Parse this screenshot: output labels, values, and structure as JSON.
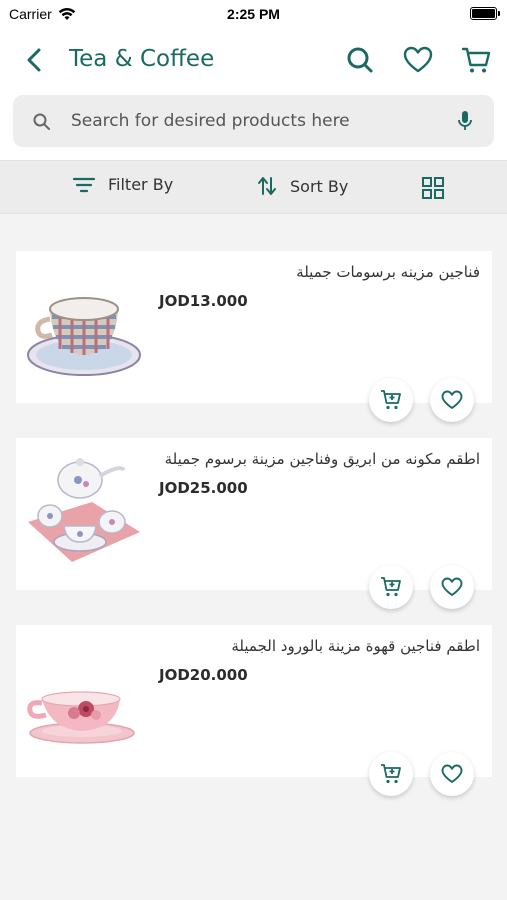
{
  "status_bar": {
    "carrier": "Carrier",
    "time": "2:25 PM"
  },
  "header": {
    "title": "Tea & Coffee",
    "accent_color": "#1a6a62",
    "icons": [
      "back-arrow-icon",
      "search-icon",
      "heart-icon",
      "cart-icon"
    ]
  },
  "search": {
    "placeholder": "Search for desired products here",
    "value": ""
  },
  "filter_bar": {
    "filter_label": "Filter By",
    "sort_label": "Sort By"
  },
  "products": [
    {
      "name": "فناجين مزينه برسومات جميلة",
      "price": "JOD13.000"
    },
    {
      "name": "اطقم مكونه من ابريق وفناجين مزينة برسوم جميلة",
      "price": "JOD25.000"
    },
    {
      "name": "اطقم فناجين قهوة مزينة بالورود الجميلة",
      "price": "JOD20.000"
    }
  ]
}
